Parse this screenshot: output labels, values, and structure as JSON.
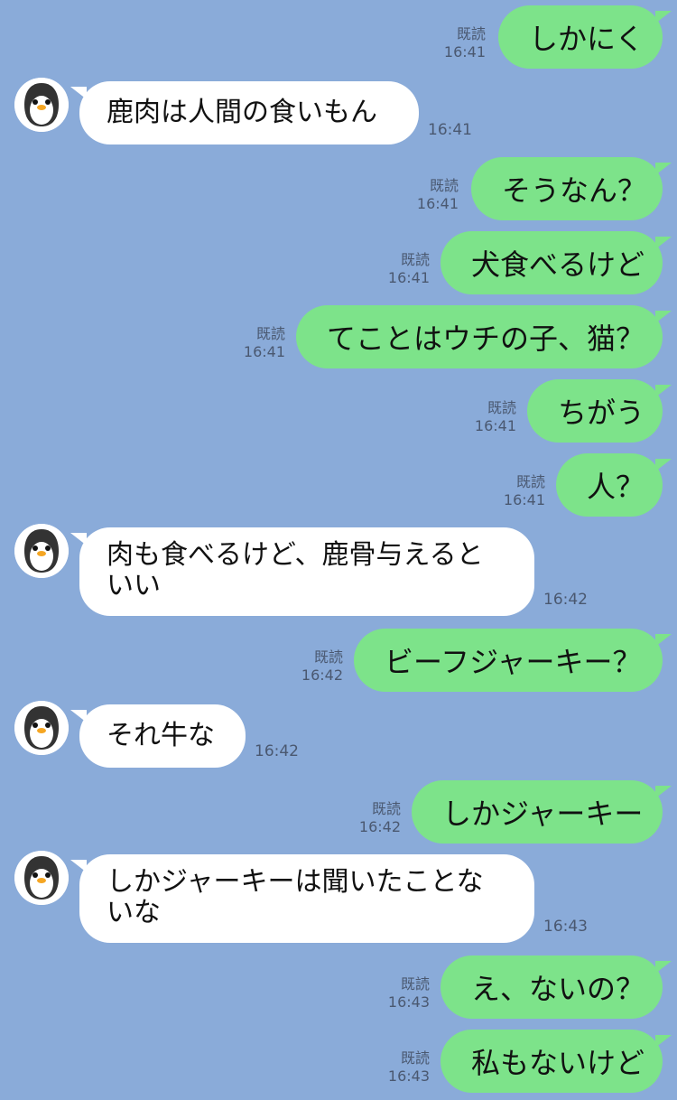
{
  "read_label": "既読",
  "messages": [
    {
      "side": "out",
      "text": "しかにく",
      "time": "16:41"
    },
    {
      "side": "in",
      "text": "鹿肉は人間の食いもん",
      "time": "16:41"
    },
    {
      "side": "out",
      "text": "そうなん？",
      "time": "16:41"
    },
    {
      "side": "out",
      "text": "犬食べるけど",
      "time": "16:41"
    },
    {
      "side": "out",
      "text": "てことはウチの子、猫？",
      "time": "16:41"
    },
    {
      "side": "out",
      "text": "ちがう",
      "time": "16:41"
    },
    {
      "side": "out",
      "text": "人？",
      "time": "16:41"
    },
    {
      "side": "in",
      "text": "肉も食べるけど、鹿骨与えるといい",
      "time": "16:42"
    },
    {
      "side": "out",
      "text": "ビーフジャーキー？",
      "time": "16:42"
    },
    {
      "side": "in",
      "text": "それ牛な",
      "time": "16:42"
    },
    {
      "side": "out",
      "text": "しかジャーキー",
      "time": "16:42"
    },
    {
      "side": "in",
      "text": "しかジャーキーは聞いたことないな",
      "time": "16:43"
    },
    {
      "side": "out",
      "text": "え、ないの？",
      "time": "16:43"
    },
    {
      "side": "out",
      "text": "私もないけど",
      "time": "16:43"
    }
  ],
  "colors": {
    "background": "#8aabd9",
    "sent_bubble": "#7de38a",
    "received_bubble": "#ffffff"
  },
  "avatar_icon": "penguin-icon"
}
